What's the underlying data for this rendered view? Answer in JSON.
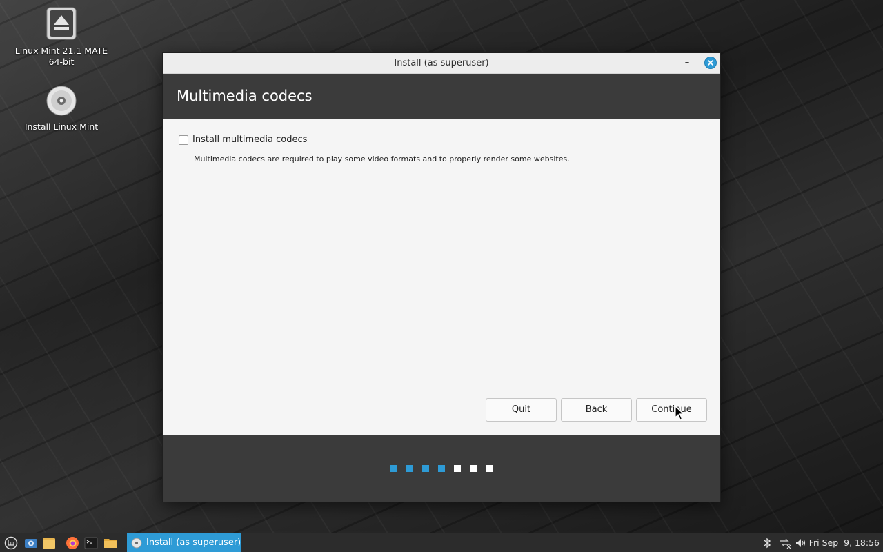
{
  "desktop": {
    "icons": [
      {
        "label_line1": "Linux Mint 21.1 MATE",
        "label_line2": "64-bit",
        "icon": "eject-drive-icon"
      },
      {
        "label": "Install Linux Mint",
        "icon": "disc-icon"
      }
    ]
  },
  "window": {
    "title": "Install (as superuser)",
    "minimize_symbol": "–",
    "header_title": "Multimedia codecs",
    "checkbox_label": "Install multimedia codecs",
    "checkbox_checked": false,
    "description": "Multimedia codecs are required to play some video formats and to properly render some websites.",
    "buttons": {
      "quit": "Quit",
      "back": "Back",
      "continue": "Continue"
    },
    "progress": {
      "total_steps": 7,
      "completed_steps": 4
    },
    "colors": {
      "accent": "#2e9bd6",
      "header_bg": "#3b3b3b"
    }
  },
  "taskbar": {
    "launchers": [
      "mint-menu-icon",
      "screenshot-icon",
      "files-icon",
      "firefox-icon",
      "terminal-icon",
      "folder-icon"
    ],
    "active_task": "Install (as superuser)",
    "tray": [
      "bluetooth-icon",
      "network-icon",
      "volume-icon"
    ],
    "clock": "Fri Sep  9, 18:56"
  }
}
